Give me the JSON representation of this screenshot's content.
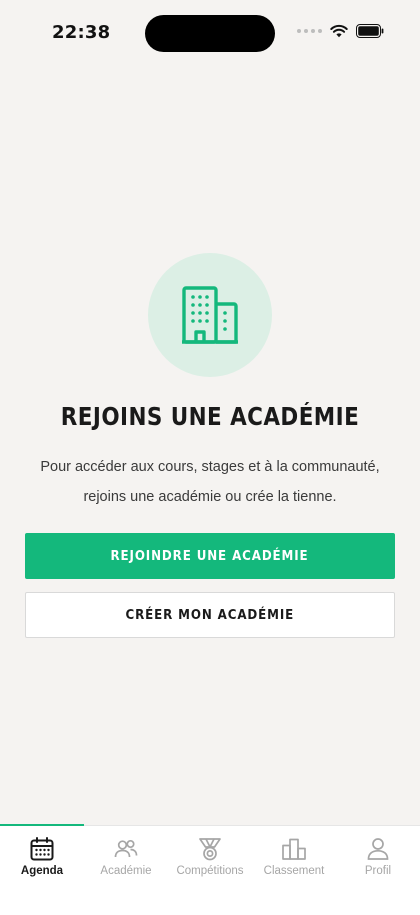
{
  "status_bar": {
    "time": "22:38"
  },
  "hero": {
    "icon": "building-icon"
  },
  "empty_state": {
    "title": "REJOINS UNE ACADÉMIE",
    "subtitle_line1": "Pour accéder aux cours, stages et à la communauté,",
    "subtitle_line2": "rejoins une académie ou crée la tienne."
  },
  "actions": {
    "join_label": "REJOINDRE UNE ACADÉMIE",
    "create_label": "CRÉER MON ACADÉMIE"
  },
  "tabbar": {
    "active": "Agenda",
    "items": [
      {
        "label": "Agenda",
        "icon": "calendar-icon"
      },
      {
        "label": "Académie",
        "icon": "users-icon"
      },
      {
        "label": "Compétitions",
        "icon": "medal-icon"
      },
      {
        "label": "Classement",
        "icon": "podium-icon"
      },
      {
        "label": "Profil",
        "icon": "user-icon"
      }
    ]
  },
  "colors": {
    "accent": "#14b87c",
    "background": "#f5f3f1",
    "hero_circle": "#dcefe5"
  }
}
